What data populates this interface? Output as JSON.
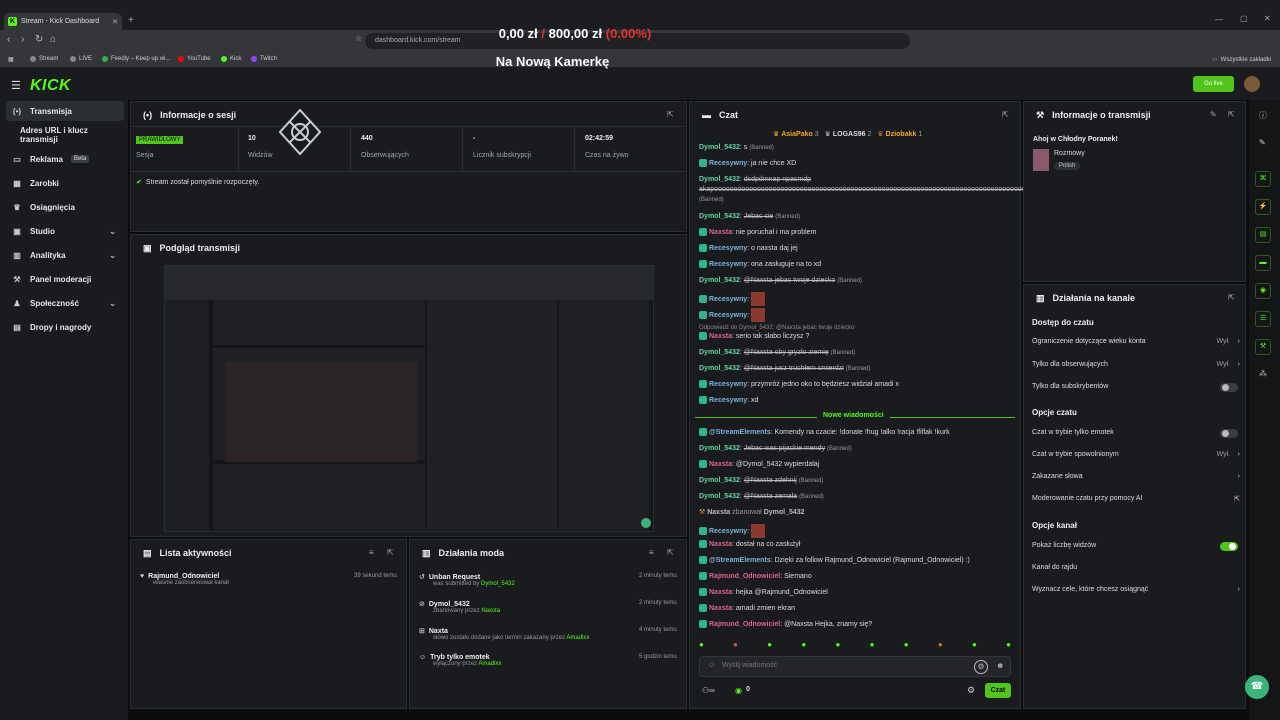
{
  "browser": {
    "tab_title": "Stream - Kick Dashboard",
    "new_tab": "+",
    "url_host": "dashboard.kick.com",
    "url_path": "/stream",
    "all_bookmarks": "Wszystkie zakładki",
    "bookmarks": [
      "Stream",
      "LIVE",
      "Feedly – Keep up wi...",
      "YouTube",
      "Kick",
      "Twitch"
    ]
  },
  "overlay": {
    "amount": "0,00 zł",
    "sep": "/",
    "goal": "800,00 zł",
    "pct": "(0.00%)",
    "caption": "Na Nową Kamerkę"
  },
  "header": {
    "logo": "KICK",
    "go_live": "Go live"
  },
  "sidebar": {
    "items": [
      {
        "label": "Transmisja",
        "icon": "(•)"
      },
      {
        "label": "Adres URL i klucz transmisji",
        "icon": ""
      },
      {
        "label": "Reklama",
        "badge": "Beta",
        "icon": "▭"
      },
      {
        "label": "Zarobki",
        "icon": "▦"
      },
      {
        "label": "Osiągnięcia",
        "icon": "♛"
      },
      {
        "label": "Studio",
        "icon": "▣"
      },
      {
        "label": "Analityka",
        "icon": "▥"
      },
      {
        "label": "Panel moderacji",
        "icon": "⚒"
      },
      {
        "label": "Społeczność",
        "icon": "♟"
      },
      {
        "label": "Dropy i nagrody",
        "icon": "▤"
      }
    ]
  },
  "session": {
    "title": "Informacje o sesji",
    "status_badge": "PRAWIDŁOWY",
    "stats": [
      {
        "value": "",
        "label": "Sesja"
      },
      {
        "value": "10",
        "label": "Widzów"
      },
      {
        "value": "440",
        "label": "Obserwujących"
      },
      {
        "value": "-",
        "label": "Licznik subskrypcji"
      },
      {
        "value": "02:42:59",
        "label": "Czas na żywo"
      }
    ],
    "message": "Stream został pomyślnie rozpoczęty."
  },
  "preview": {
    "title": "Podgląd transmisji"
  },
  "activity": {
    "title": "Lista aktywności",
    "items": [
      {
        "user": "Rajmund_Odnowiciel",
        "text": "właśnie zaobserwował kanał",
        "time": "39 sekund temu"
      }
    ]
  },
  "modactions": {
    "title": "Działania moda",
    "items": [
      {
        "title": "Unban Request",
        "prefix": "was submitted by",
        "who": "Dymol_5432",
        "time": "2 minuty temu"
      },
      {
        "title": "Dymol_5432",
        "prefix": "zbanowany przez",
        "who": "Naxsta",
        "time": "2 minuty temu"
      },
      {
        "title": "Naxta",
        "prefix": "słowo zostało dodane jako termin zakazany przez",
        "who": "Amadixx",
        "time": "4 minuty temu"
      },
      {
        "title": "Tryb tylko emotek",
        "prefix": "wyłączony przez",
        "who": "Amadixx",
        "time": "5 godzin temu"
      }
    ]
  },
  "chat": {
    "title": "Czat",
    "top_gifters": [
      {
        "name": "AsiaPako",
        "count": "3"
      },
      {
        "name": "LOGAS96",
        "count": "2"
      },
      {
        "name": "Dziobakk",
        "count": "1"
      }
    ],
    "banned_tag": "(Banned)",
    "new_messages": "Nowe wiadomości",
    "lines": [
      {
        "user": "Dymol_5432",
        "text": "s",
        "banned": true,
        "struck": false
      },
      {
        "user": "Recesywny",
        "text": "ja nie chce XD",
        "banned": false,
        "struck": false
      },
      {
        "user": "Dymol_5432",
        "text": "dsdpdmnap npasmdp akapoooooooooooooooooooooooooooooooooooooooooooooooooooooooooooooooooooooooooooooooo",
        "banned": true,
        "struck": true
      },
      {
        "user": "Dymol_5432",
        "text": "Jebac cie",
        "banned": true,
        "struck": true
      },
      {
        "user": "Naxsta",
        "text": "nie poruchał i ma problem",
        "banned": false,
        "struck": false
      },
      {
        "user": "Recesywny",
        "text": "o naxsta daj jej",
        "banned": false,
        "struck": false
      },
      {
        "user": "Recesywny",
        "text": "ona zasługuje na to xd",
        "banned": false,
        "struck": false
      },
      {
        "user": "Dymol_5432",
        "text": "@Naxsta jebac twoje dziecko",
        "banned": true,
        "struck": true
      },
      {
        "user": "Recesywny",
        "text": "",
        "banned": false,
        "struck": false
      },
      {
        "user": "Recesywny",
        "text": "",
        "banned": false,
        "struck": false
      },
      {
        "user": "Naxsta",
        "text": "serio tak słabo liczysz ?",
        "banned": false,
        "struck": false
      },
      {
        "user": "Dymol_5432",
        "text": "@Naxsta oby gryzło ziemię",
        "banned": true,
        "struck": true
      },
      {
        "user": "Dymol_5432",
        "text": "@Naxsta jusz truchłem smierdzi",
        "banned": true,
        "struck": true
      },
      {
        "user": "Recesywny",
        "text": "przymróż jedno oko to będziesz widział amadi x",
        "banned": false,
        "struck": false
      },
      {
        "user": "Recesywny",
        "text": "xd",
        "banned": false,
        "struck": false
      }
    ],
    "reply_hint": "Odpowiedź do Dymol_5432: @Naxsta jebac twoje dziecko",
    "lines2": [
      {
        "user": "@StreamElements",
        "text": "Komendy na czacie: !donate !hug !alko !racja !fiflak !kurk",
        "banned": false,
        "struck": false
      },
      {
        "user": "Dymol_5432",
        "text": "Jebac was pijackie mendy",
        "banned": true,
        "struck": true
      },
      {
        "user": "Naxsta",
        "text": "@Dymol_5432 wypierdalaj",
        "banned": false,
        "struck": false
      },
      {
        "user": "Dymol_5432",
        "text": "@Naxsta zdehnij",
        "banned": true,
        "struck": true
      },
      {
        "user": "Dymol_5432",
        "text": "@Naxsta zemała",
        "banned": true,
        "struck": true
      }
    ],
    "ban_notice": {
      "who": "Naxsta",
      "text": "zbanował",
      "target": "Dymol_5432"
    },
    "lines3": [
      {
        "user": "Recesywny",
        "text": "",
        "banned": false,
        "struck": false
      },
      {
        "user": "Naxsta",
        "text": "dostał na co zasłużył",
        "banned": false,
        "struck": false
      },
      {
        "user": "@StreamElements",
        "text": "Dzięki za follow Rajmund_Odnowiciel (Rajmund_Odnowiciel) :)",
        "banned": false,
        "struck": false
      },
      {
        "user": "Rajmund_Odnowiciel",
        "text": "Siemano",
        "banned": false,
        "struck": false
      },
      {
        "user": "Naxsta",
        "text": "hejka @Rajmund_Odnowiciel",
        "banned": false,
        "struck": false
      },
      {
        "user": "Naxsta",
        "text": "amadi zmien ekran",
        "banned": false,
        "struck": false
      },
      {
        "user": "Rajmund_Odnowiciel",
        "text": "@Naxsta Hejka, znamy się?",
        "banned": false,
        "struck": false
      }
    ],
    "input_placeholder": "Wyślij wiadomość",
    "viewers_icon_value": "0",
    "send": "Czat"
  },
  "stream_info": {
    "title": "Informacje o transmisji",
    "stream_title": "Ahoj w Chłodny Poranek!",
    "category": "Rozmowy",
    "tag": "Polish"
  },
  "channel_actions": {
    "title": "Działania na kanale",
    "sections": [
      {
        "heading": "Dostęp do czatu",
        "rows": [
          {
            "label": "Ograniczenie dotyczące wieku konta",
            "value": "Wył.",
            "kind": "chevron"
          },
          {
            "label": "Tylko dla obserwujących",
            "value": "Wył.",
            "kind": "chevron"
          },
          {
            "label": "Tylko dla subskrybentów",
            "value": "",
            "kind": "toggle-off"
          }
        ]
      },
      {
        "heading": "Opcje czatu",
        "rows": [
          {
            "label": "Czat w trybie tylko emotek",
            "value": "",
            "kind": "toggle-off"
          },
          {
            "label": "Czat w trybie spowolnionym",
            "value": "Wył.",
            "kind": "chevron"
          },
          {
            "label": "Zakazane słowa",
            "value": "",
            "kind": "chevron"
          },
          {
            "label": "Moderowanie czatu przy pomocy AI",
            "value": "",
            "kind": "external"
          }
        ]
      },
      {
        "heading": "Opcje kanał",
        "rows": [
          {
            "label": "Pokaż liczbę widzów",
            "value": "",
            "kind": "toggle-on"
          },
          {
            "label": "Kanał do rajdu",
            "value": "",
            "kind": "none"
          },
          {
            "label": "Wyznacz cele, które chcesz osiągnąć",
            "value": "",
            "kind": "chevron"
          }
        ]
      }
    ]
  },
  "colors": {
    "brand": "#53fc18",
    "panel": "#191b1f",
    "bg": "#0b0c0d"
  }
}
